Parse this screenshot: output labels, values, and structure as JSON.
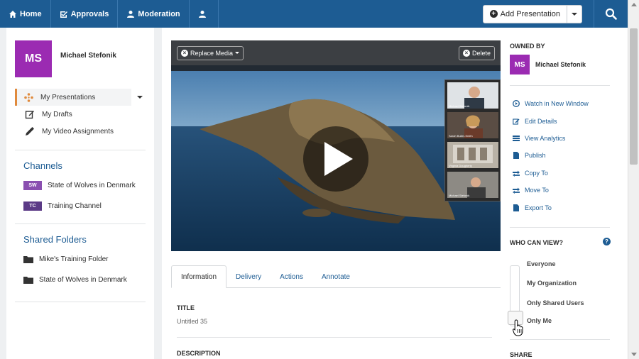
{
  "nav": {
    "home": "Home",
    "approvals": "Approvals",
    "moderation": "Moderation",
    "add_presentation": "Add Presentation"
  },
  "user": {
    "initials": "MS",
    "name": "Michael Stefonik",
    "avatar_color": "#9b2bb2"
  },
  "menu": [
    {
      "label": "My Presentations",
      "icon": "presentations-icon"
    },
    {
      "label": "My Drafts",
      "icon": "edit-icon"
    },
    {
      "label": "My Video Assignments",
      "icon": "pencil-icon"
    }
  ],
  "channels": {
    "title": "Channels",
    "items": [
      {
        "badge": "SW",
        "label": "State of Wolves in Denmark",
        "color": "#8a4fb0"
      },
      {
        "badge": "TC",
        "label": "Training Channel",
        "color": "#5b3a86"
      }
    ]
  },
  "shared_folders": {
    "title": "Shared Folders",
    "items": [
      {
        "label": "Mike's Training Folder"
      },
      {
        "label": "State of Wolves in Denmark"
      }
    ]
  },
  "video": {
    "replace_label": "Replace Media",
    "delete_label": "Delete",
    "participants": [
      "Michael Stefonik",
      "Sarah Buller-Smith",
      "Virginia Dougherty",
      "Michael Stefonik"
    ]
  },
  "tabs": [
    "Information",
    "Delivery",
    "Actions",
    "Annotate"
  ],
  "fields": {
    "title_label": "TITLE",
    "title_value": "Untitled 35",
    "description_label": "DESCRIPTION"
  },
  "owned_by": {
    "heading": "OWNED BY",
    "initials": "MS",
    "name": "Michael Stefonik"
  },
  "actions": [
    {
      "label": "Watch in New Window",
      "icon": "play-circle-icon"
    },
    {
      "label": "Edit Details",
      "icon": "edit-icon"
    },
    {
      "label": "View Analytics",
      "icon": "analytics-icon"
    },
    {
      "label": "Publish",
      "icon": "publish-icon"
    },
    {
      "label": "Copy To",
      "icon": "copy-icon"
    },
    {
      "label": "Move To",
      "icon": "move-icon"
    },
    {
      "label": "Export To",
      "icon": "export-icon"
    }
  ],
  "who_can_view": {
    "heading": "WHO CAN VIEW?",
    "options": [
      "Everyone",
      "My Organization",
      "Only Shared Users",
      "Only Me"
    ],
    "selected": "Only Me"
  },
  "share": {
    "heading": "SHARE"
  },
  "colors": {
    "nav": "#1d5c93",
    "accent": "#e08a3c",
    "link": "#1d5c93"
  }
}
